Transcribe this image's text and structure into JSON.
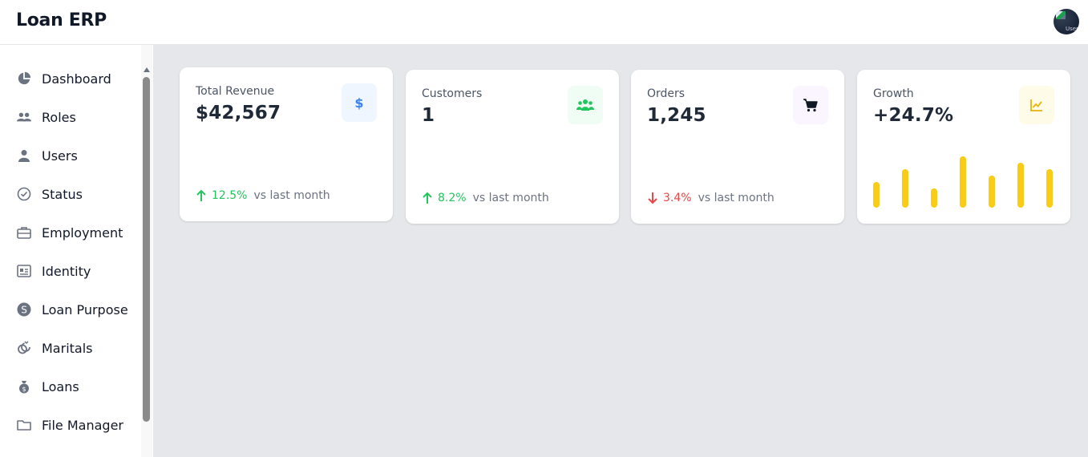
{
  "header": {
    "app_title": "Loan ERP",
    "avatar_alt": "User"
  },
  "sidebar": {
    "items": [
      {
        "label": "Dashboard",
        "icon": "pie-chart-icon"
      },
      {
        "label": "Roles",
        "icon": "users-icon"
      },
      {
        "label": "Users",
        "icon": "user-icon"
      },
      {
        "label": "Status",
        "icon": "check-circle-icon"
      },
      {
        "label": "Employment",
        "icon": "briefcase-icon"
      },
      {
        "label": "Identity",
        "icon": "id-card-icon"
      },
      {
        "label": "Loan Purpose",
        "icon": "dollar-circle-icon"
      },
      {
        "label": "Maritals",
        "icon": "rings-icon"
      },
      {
        "label": "Loans",
        "icon": "money-bag-icon"
      },
      {
        "label": "File Manager",
        "icon": "folder-icon"
      }
    ]
  },
  "cards": [
    {
      "title": "Total Revenue",
      "value": "$42,567",
      "icon": "dollar-icon",
      "icon_color": "#3b82f6",
      "icon_bg": "#eff6ff",
      "trend_direction": "up",
      "trend_value": "12.5%",
      "trend_label": "vs last month",
      "trend_color": "#22c55e"
    },
    {
      "title": "Customers",
      "value": "1",
      "icon": "users-icon",
      "icon_color": "#22c55e",
      "icon_bg": "#f0fdf4",
      "trend_direction": "up",
      "trend_value": "8.2%",
      "trend_label": "vs last month",
      "trend_color": "#22c55e"
    },
    {
      "title": "Orders",
      "value": "1,245",
      "icon": "shopping-cart-icon",
      "icon_color": "#111827",
      "icon_bg": "#faf5ff",
      "trend_direction": "down",
      "trend_value": "3.4%",
      "trend_label": "vs last month",
      "trend_color": "#ef4444"
    },
    {
      "title": "Growth",
      "value": "+24.7%",
      "icon": "chart-line-icon",
      "icon_color": "#eab308",
      "icon_bg": "#fefce8"
    }
  ],
  "growth_bars": {
    "values": [
      40,
      60,
      30,
      80,
      50,
      70,
      60
    ],
    "max": 80,
    "color": "#facc15"
  }
}
